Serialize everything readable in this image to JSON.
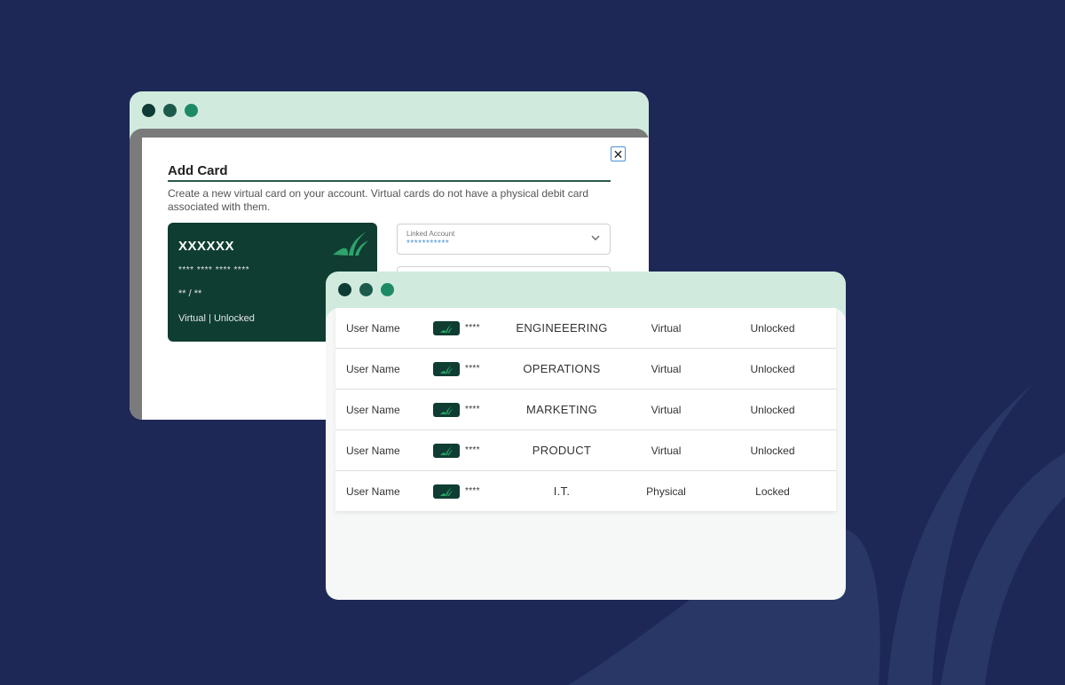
{
  "colors": {
    "background": "#1d2856",
    "window_chrome": "#d0ebde",
    "card_green": "#0f3d32",
    "brand_accent": "#2fa36b",
    "dot_1": "#0e3b33",
    "dot_2": "#1d5a4c",
    "dot_3": "#1d8a66"
  },
  "add_card_window": {
    "close_label": "✕",
    "title": "Add Card",
    "description": "Create a new virtual card on your account. Virtual cards do not have a physical debit card associated with them.",
    "card_preview": {
      "name": "XXXXXX",
      "number": "**** **** **** ****",
      "expiry": "** / **",
      "status": "Virtual | Unlocked",
      "logo_icon": "brand-leaf-logo"
    },
    "linked_account": {
      "label": "Linked Account",
      "value": "***********",
      "icon": "chevron-down-icon"
    }
  },
  "cards_table": {
    "rows": [
      {
        "user": "User Name",
        "card_digits": "****",
        "department": "ENGINEEERING",
        "type": "Virtual",
        "status": "Unlocked"
      },
      {
        "user": "User Name",
        "card_digits": "****",
        "department": "OPERATIONS",
        "type": "Virtual",
        "status": "Unlocked"
      },
      {
        "user": "User Name",
        "card_digits": "****",
        "department": "MARKETING",
        "type": "Virtual",
        "status": "Unlocked"
      },
      {
        "user": "User Name",
        "card_digits": "****",
        "department": "PRODUCT",
        "type": "Virtual",
        "status": "Unlocked"
      },
      {
        "user": "User Name",
        "card_digits": "****",
        "department": "I.T.",
        "type": "Physical",
        "status": "Locked"
      }
    ]
  }
}
